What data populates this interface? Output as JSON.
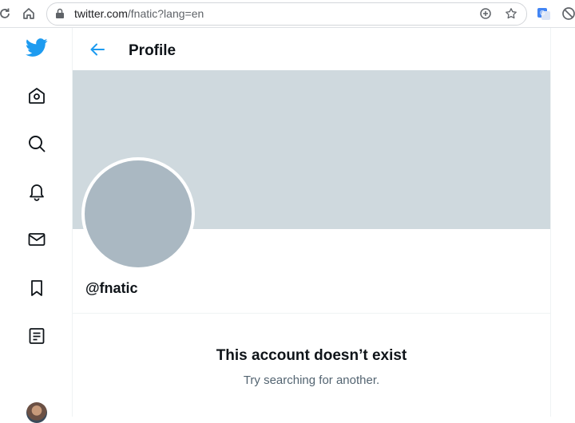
{
  "browser": {
    "url_host": "twitter.com",
    "url_path": "/fnatic?lang=en"
  },
  "sidenav": {
    "items": [
      "twitter-logo",
      "home-icon",
      "search-icon",
      "notifications-icon",
      "messages-icon",
      "bookmarks-icon",
      "lists-icon"
    ]
  },
  "header": {
    "title": "Profile"
  },
  "profile": {
    "handle": "@fnatic"
  },
  "empty_state": {
    "title": "This account doesn’t exist",
    "subtitle": "Try searching for another."
  },
  "colors": {
    "accent": "#1d9bf0",
    "banner": "#cfd9de",
    "avatar_placeholder": "#aab8c2",
    "secondary_text": "#536471"
  }
}
